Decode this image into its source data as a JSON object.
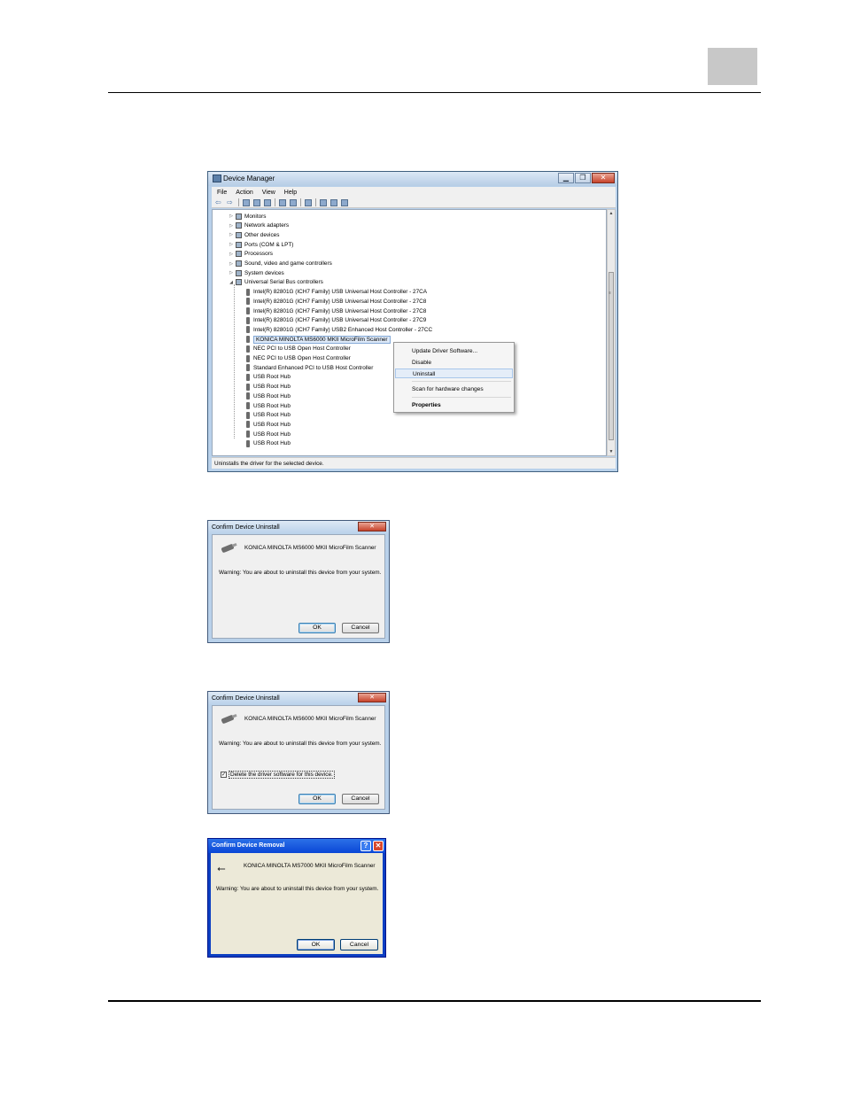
{
  "device_manager": {
    "title": "Device Manager",
    "window_buttons": [
      "▁",
      "❐",
      "✕"
    ],
    "menu": [
      "File",
      "Action",
      "View",
      "Help"
    ],
    "tree": [
      {
        "label": "Monitors",
        "level": 1,
        "expander": "▷"
      },
      {
        "label": "Network adapters",
        "level": 1,
        "expander": "▷"
      },
      {
        "label": "Other devices",
        "level": 1,
        "expander": "▷"
      },
      {
        "label": "Ports (COM & LPT)",
        "level": 1,
        "expander": "▷"
      },
      {
        "label": "Processors",
        "level": 1,
        "expander": "▷"
      },
      {
        "label": "Sound, video and game controllers",
        "level": 1,
        "expander": "▷"
      },
      {
        "label": "System devices",
        "level": 1,
        "expander": "▷"
      },
      {
        "label": "Universal Serial Bus controllers",
        "level": 1,
        "expander": "◢"
      },
      {
        "label": "Intel(R) 82801G (ICH7 Family) USB Universal Host Controller - 27CA",
        "level": 2
      },
      {
        "label": "Intel(R) 82801G (ICH7 Family) USB Universal Host Controller - 27C8",
        "level": 2
      },
      {
        "label": "Intel(R) 82801G (ICH7 Family) USB Universal Host Controller - 27C8",
        "level": 2
      },
      {
        "label": "Intel(R) 82801G (ICH7 Family) USB Universal Host Controller - 27C9",
        "level": 2
      },
      {
        "label": "Intel(R) 82801G (ICH7 Family) USB2 Enhanced Host Controller - 27CC",
        "level": 2
      },
      {
        "label": "KONICA MINOLTA MS6000 MKII MicroFilm Scanner",
        "level": 2,
        "selected": true
      },
      {
        "label": "NEC PCI to USB Open Host Controller",
        "level": 2
      },
      {
        "label": "NEC PCI to USB Open Host Controller",
        "level": 2
      },
      {
        "label": "Standard Enhanced PCI to USB Host Controller",
        "level": 2
      },
      {
        "label": "USB Root Hub",
        "level": 2
      },
      {
        "label": "USB Root Hub",
        "level": 2
      },
      {
        "label": "USB Root Hub",
        "level": 2
      },
      {
        "label": "USB Root Hub",
        "level": 2
      },
      {
        "label": "USB Root Hub",
        "level": 2
      },
      {
        "label": "USB Root Hub",
        "level": 2
      },
      {
        "label": "USB Root Hub",
        "level": 2
      },
      {
        "label": "USB Root Hub",
        "level": 2
      }
    ],
    "context_menu": {
      "update": "Update Driver Software...",
      "disable": "Disable",
      "uninstall": "Uninstall",
      "scan": "Scan for hardware changes",
      "properties": "Properties"
    },
    "status": "Uninstalls the driver for the selected device."
  },
  "dialog1": {
    "title": "Confirm Device Uninstall",
    "close": "✕",
    "device": "KONICA MINOLTA MS6000 MKII MicroFilm Scanner",
    "warning": "Warning: You are about to uninstall this device from your system.",
    "ok": "OK",
    "cancel": "Cancel"
  },
  "dialog2": {
    "title": "Confirm Device Uninstall",
    "close": "✕",
    "device": "KONICA MINOLTA MS6000 MKII MicroFilm Scanner",
    "warning": "Warning: You are about to uninstall this device from your system.",
    "checkbox_mark": "✓",
    "checkbox": "Delete the driver software for this device.",
    "ok": "OK",
    "cancel": "Cancel"
  },
  "dialog3": {
    "title": "Confirm Device Removal",
    "help": "?",
    "close": "✕",
    "device": "KONICA MINOLTA MS7000 MKII MicroFilm Scanner",
    "warning": "Warning: You are about to uninstall this device from your system.",
    "usb_symbol": "⭠",
    "ok": "OK",
    "cancel": "Cancel"
  }
}
